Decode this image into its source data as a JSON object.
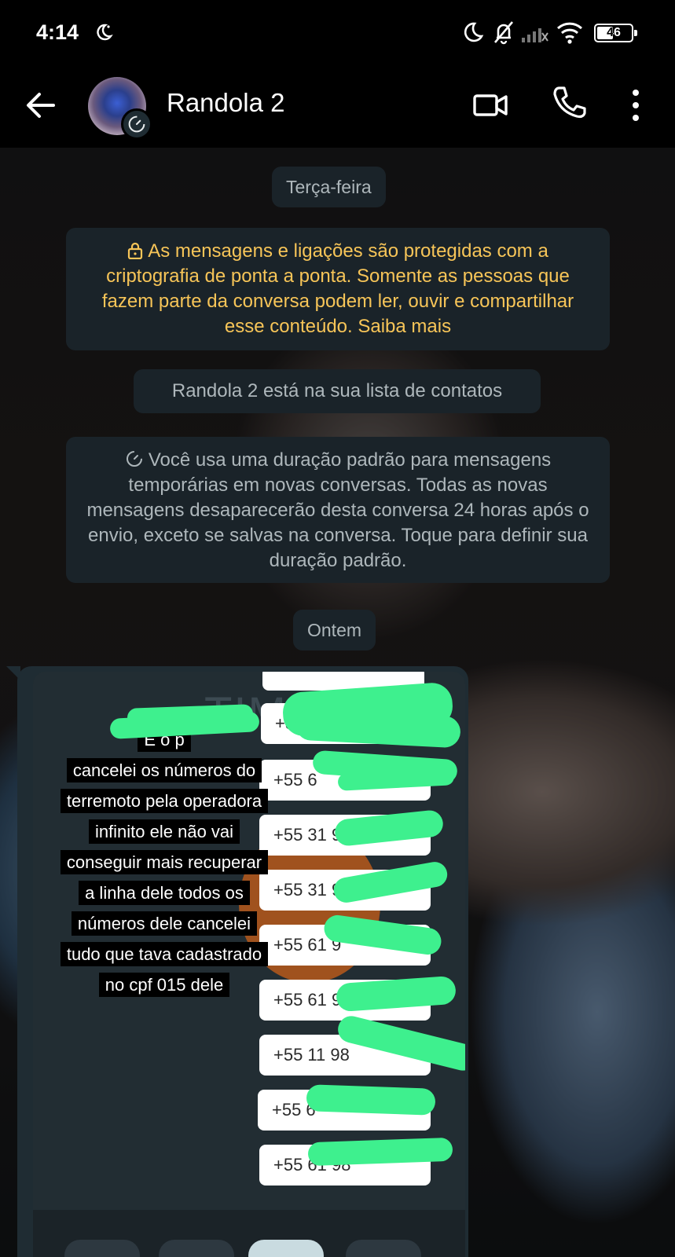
{
  "status_bar": {
    "time": "4:14",
    "battery": "46"
  },
  "header": {
    "contact_name": "Randola 2",
    "icons": [
      "back-arrow-icon",
      "video-call-icon",
      "phone-icon",
      "more-vert-icon"
    ]
  },
  "chat": {
    "date_chip_1": "Terça-feira",
    "encryption_notice": "As mensagens e ligações são protegidas com a criptografia de ponta a ponta. Somente as pessoas que fazem parte da conversa podem ler, ouvir e compartilhar esse conteúdo. Saiba mais",
    "contact_notice": "Randola 2 está na sua lista de contatos",
    "timer_notice": "Você usa uma duração padrão para mensagens temporárias em novas conversas. Todas as novas mensagens desaparecerão desta conversa 24 horas após o envio, exceto se salvas na conversa. Toque para definir sua duração padrão.",
    "date_chip_2": "Ontem"
  },
  "image_message": {
    "logo_text": "TIM",
    "story_lines": [
      "É o p",
      "cancelei os números do",
      "terremoto pela operadora",
      "infinito ele não vai",
      "conseguir mais recuperar",
      "a linha dele todos os",
      "números dele cancelei",
      "tudo que tava cadastrado",
      "no cpf 015 dele"
    ],
    "phone_numbers": [
      "+55",
      "+55 6",
      "+55 31 9",
      "+55 31 97",
      "+55 61 9",
      "+55 61 981",
      "+55 11 98",
      "+55 6",
      "+55 61 98"
    ],
    "redaction_color": "#3ef08e"
  },
  "colors": {
    "notice_yellow": "#f7c558",
    "chip_bg": "#1a2329",
    "header_bg": "#000000"
  }
}
